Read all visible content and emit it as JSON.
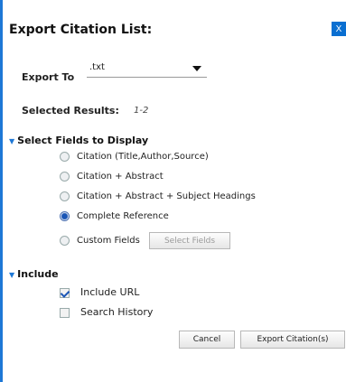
{
  "dialog": {
    "title": "Export Citation List:",
    "close_label": "X"
  },
  "export_to": {
    "label": "Export To",
    "value": ".txt"
  },
  "selected": {
    "label": "Selected Results:",
    "value": "1-2"
  },
  "fields": {
    "heading": "Select Fields to Display",
    "options": [
      {
        "label": "Citation (Title,Author,Source)",
        "selected": false
      },
      {
        "label": "Citation + Abstract",
        "selected": false
      },
      {
        "label": "Citation + Abstract + Subject Headings",
        "selected": false
      },
      {
        "label": "Complete Reference",
        "selected": true
      },
      {
        "label": "Custom Fields",
        "selected": false
      }
    ],
    "select_fields_button": "Select Fields"
  },
  "include": {
    "heading": "Include",
    "items": [
      {
        "label": "Include URL",
        "checked": true
      },
      {
        "label": "Search History",
        "checked": false
      }
    ]
  },
  "actions": {
    "cancel": "Cancel",
    "export": "Export Citation(s)"
  },
  "colors": {
    "accent": "#1e78d6",
    "close_bg": "#0a6fd1"
  }
}
